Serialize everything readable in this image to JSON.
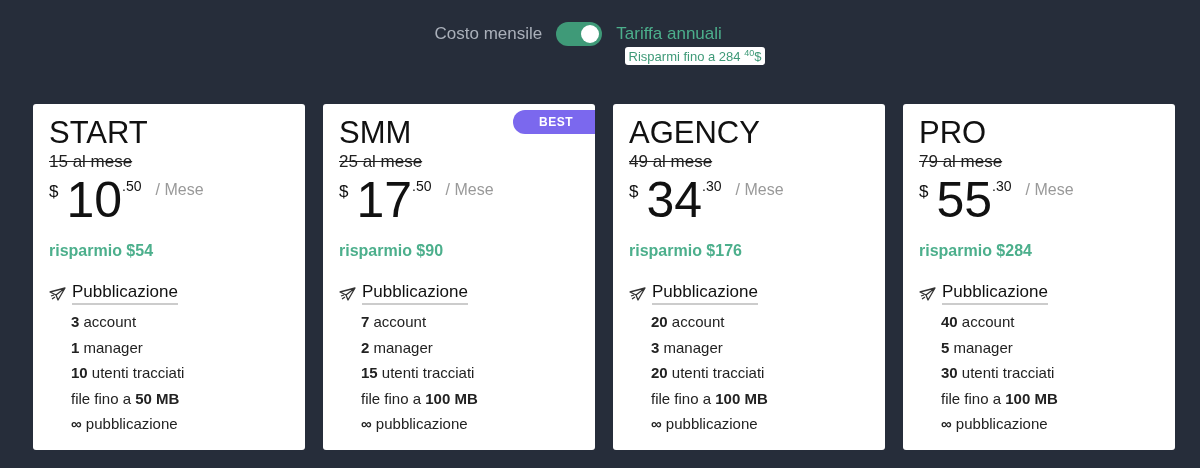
{
  "billing_toggle": {
    "left_label": "Costo mensile",
    "right_label": "Tariffa annuali",
    "on": true,
    "savings_badge": "Risparmi fino a 284 $^{40}$$"
  },
  "plans": [
    {
      "name": "START",
      "old_price": "15 al mese",
      "currency": "$",
      "price": "10",
      "cents": ".50",
      "period": "/ Mese",
      "savings": "risparmio $54",
      "feature_title": "Pubblicazione",
      "features": [
        "**3** account",
        "**1** manager",
        "**10** utenti tracciati",
        "file fino a **50 MB**",
        "**∞** pubblicazione"
      ]
    },
    {
      "name": "SMM",
      "badge": "BEST",
      "old_price": "25 al mese",
      "currency": "$",
      "price": "17",
      "cents": ".50",
      "period": "/ Mese",
      "savings": "risparmio $90",
      "feature_title": "Pubblicazione",
      "features": [
        "**7** account",
        "**2** manager",
        "**15** utenti tracciati",
        "file fino a **100 MB**",
        "**∞** pubblicazione"
      ]
    },
    {
      "name": "AGENCY",
      "old_price": "49 al mese",
      "currency": "$",
      "price": "34",
      "cents": ".30",
      "period": "/ Mese",
      "savings": "risparmio $176",
      "feature_title": "Pubblicazione",
      "features": [
        "**20** account",
        "**3** manager",
        "**20** utenti tracciati",
        "file fino a **100 MB**",
        "**∞** pubblicazione"
      ]
    },
    {
      "name": "PRO",
      "old_price": "79 al mese",
      "currency": "$",
      "price": "55",
      "cents": ".30",
      "period": "/ Mese",
      "savings": "risparmio $284",
      "feature_title": "Pubblicazione",
      "features": [
        "**40** account",
        "**5** manager",
        "**30** utenti tracciati",
        "file fino a **100 MB**",
        "**∞** pubblicazione"
      ]
    }
  ]
}
